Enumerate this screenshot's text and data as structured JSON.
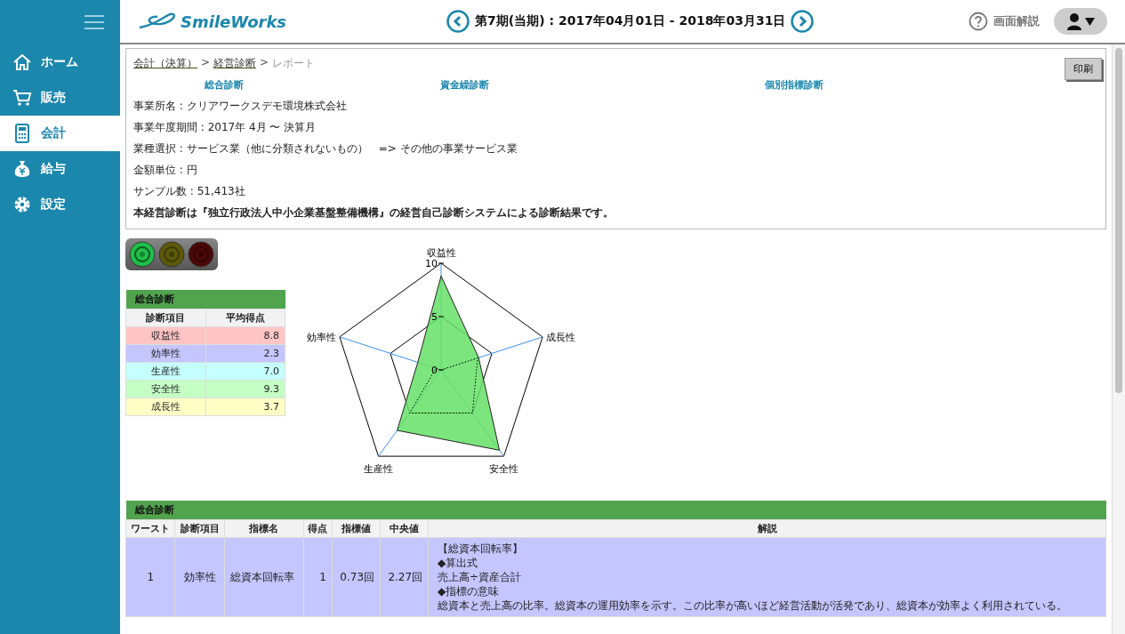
{
  "sidebar": {
    "items": [
      {
        "label": "ホーム",
        "selected": false
      },
      {
        "label": "販売",
        "selected": false
      },
      {
        "label": "会計",
        "selected": true
      },
      {
        "label": "給与",
        "selected": false
      },
      {
        "label": "設定",
        "selected": false
      }
    ]
  },
  "header": {
    "logo": "SmileWorks",
    "period": "第7期(当期) : 2017年04月01日 - 2018年03月31日",
    "help": "画面解説"
  },
  "breadcrumb": [
    {
      "label": "会計（決算）",
      "link": true
    },
    {
      "separator": ">",
      "label": "経営診断",
      "link": true
    },
    {
      "separator": ">",
      "label": "レポート",
      "link": false
    }
  ],
  "print_button": "印刷",
  "report_tabs": [
    "総合診断",
    "資金繰診断",
    "個別指標診断"
  ],
  "info_lines": [
    "事業所名 : クリアワークスデモ環境株式会社",
    "事業年度期間 : 2017年 4月 〜 決算月",
    "業種選択 : サービス業（他に分類されないもの）　=> その他の事業サービス業",
    "金額単位 : 円",
    "サンプル数 : 51,413社"
  ],
  "notice": "本経営診断は『独立行政法人中小企業基盤整備機構』の経営自己診断システムによる診断結果です。",
  "signal": [
    {
      "kind": "green",
      "selected": true
    },
    {
      "kind": "yellow",
      "selected": false
    },
    {
      "kind": "red",
      "selected": false
    }
  ],
  "summary": {
    "title": "総合診断",
    "columns": [
      "診断項目",
      "平均得点"
    ],
    "rows": [
      {
        "item": "収益性",
        "score": "8.8",
        "color": "#ffc5c5"
      },
      {
        "item": "効率性",
        "score": "2.3",
        "color": "#c5c5ff"
      },
      {
        "item": "生産性",
        "score": "7.0",
        "color": "#c5ffff"
      },
      {
        "item": "安全性",
        "score": "9.3",
        "color": "#c5ffc5"
      },
      {
        "item": "成長性",
        "score": "3.7",
        "color": "#ffffc5"
      }
    ]
  },
  "radar": {
    "chart_data": {
      "type": "radar",
      "categories": [
        "収益性",
        "成長性",
        "安全性",
        "生産性",
        "効率性"
      ],
      "ylim": [
        0,
        10
      ],
      "yticks": [
        0,
        5,
        10
      ],
      "series": [
        {
          "color": "#66e066",
          "values": [
            8.8,
            3.7,
            9.3,
            7.0,
            2.3
          ]
        },
        {
          "color": "#000000",
          "values": [
            0,
            3.6,
            5,
            5,
            0.5
          ]
        }
      ]
    }
  },
  "detail": {
    "title": "総合診断",
    "columns": [
      "ワースト",
      "診断項目",
      "指標名",
      "得点",
      "指標値",
      "中央値",
      "解説"
    ],
    "rows": [
      {
        "rank": "1",
        "item": "効率性",
        "indicator": "総資本回転率",
        "score": "1",
        "value": "0.73回",
        "median": "2.27回",
        "color": "#c5c5ff",
        "lines": [
          "【総資本回転率】",
          "◆算出式",
          "売上高÷資産合計",
          "◆指標の意味",
          "総資本と売上高の比率。総資本の運用効率を示す。この比率が高いほど経営活動が活発であり、総資本が効率よく利用されている。"
        ]
      }
    ]
  }
}
